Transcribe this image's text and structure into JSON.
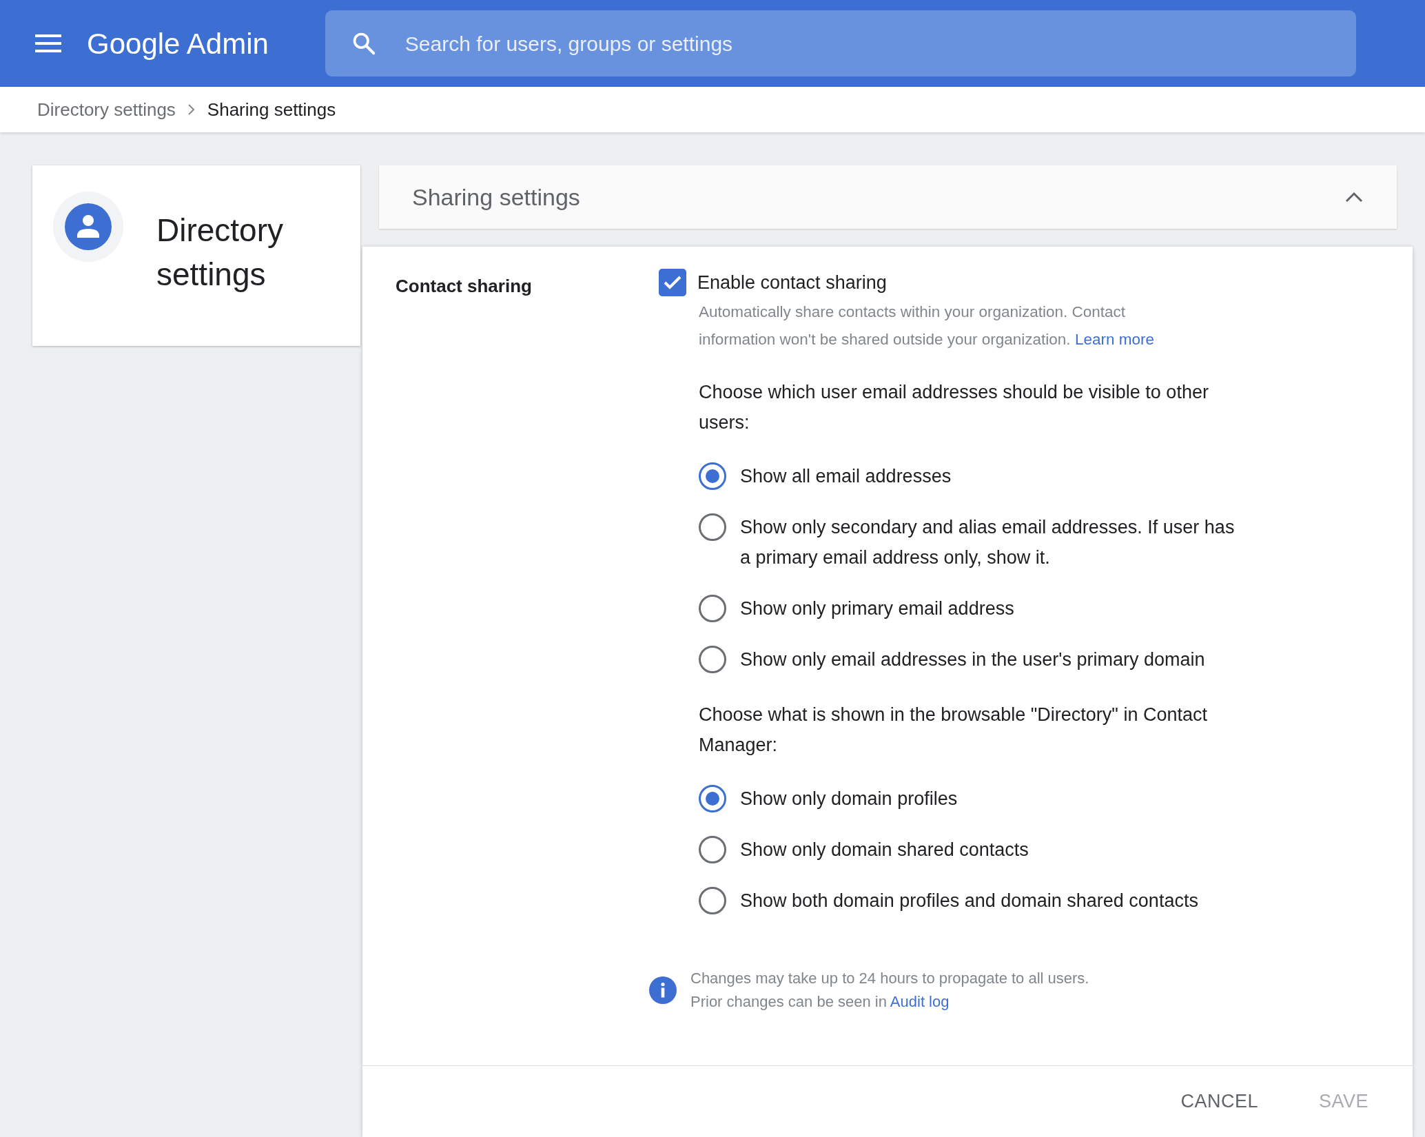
{
  "header": {
    "logo": "Google Admin",
    "search": {
      "placeholder": "Search for users, groups or settings"
    }
  },
  "breadcrumb": [
    {
      "label": "Directory settings"
    },
    {
      "label": "Sharing settings"
    }
  ],
  "sidebar_card": {
    "title": "Directory settings"
  },
  "panel": {
    "title": "Sharing settings",
    "expanded": true,
    "section_label": "Contact sharing",
    "checkbox": {
      "label": "Enable contact sharing",
      "checked": true
    },
    "description": "Automatically share contacts within your organization. Contact information won't be shared outside your organization.",
    "description_link": "Learn more",
    "groups": [
      {
        "prompt": "Choose which user email addresses should be visible to other users:",
        "options": [
          {
            "label": "Show all email addresses",
            "selected": true
          },
          {
            "label": "Show only secondary and alias email addresses. If user has a primary email address only, show it.",
            "selected": false
          },
          {
            "label": "Show only primary email address",
            "selected": false
          },
          {
            "label": "Show only email addresses in the user's primary domain",
            "selected": false
          }
        ]
      },
      {
        "prompt": "Choose what is shown in the browsable \"Directory\" in Contact Manager:",
        "options": [
          {
            "label": "Show only domain profiles",
            "selected": true
          },
          {
            "label": "Show only domain shared contacts",
            "selected": false
          },
          {
            "label": "Show both domain profiles and domain shared contacts",
            "selected": false
          }
        ]
      }
    ],
    "info": {
      "line_1": "Changes may take up to 24 hours to propagate to all users.",
      "line_2": "Prior changes can be seen in",
      "link": "Audit log"
    },
    "buttons": [
      {
        "label": "CANCEL",
        "disabled": false
      },
      {
        "label": "SAVE",
        "disabled": true
      }
    ]
  }
}
